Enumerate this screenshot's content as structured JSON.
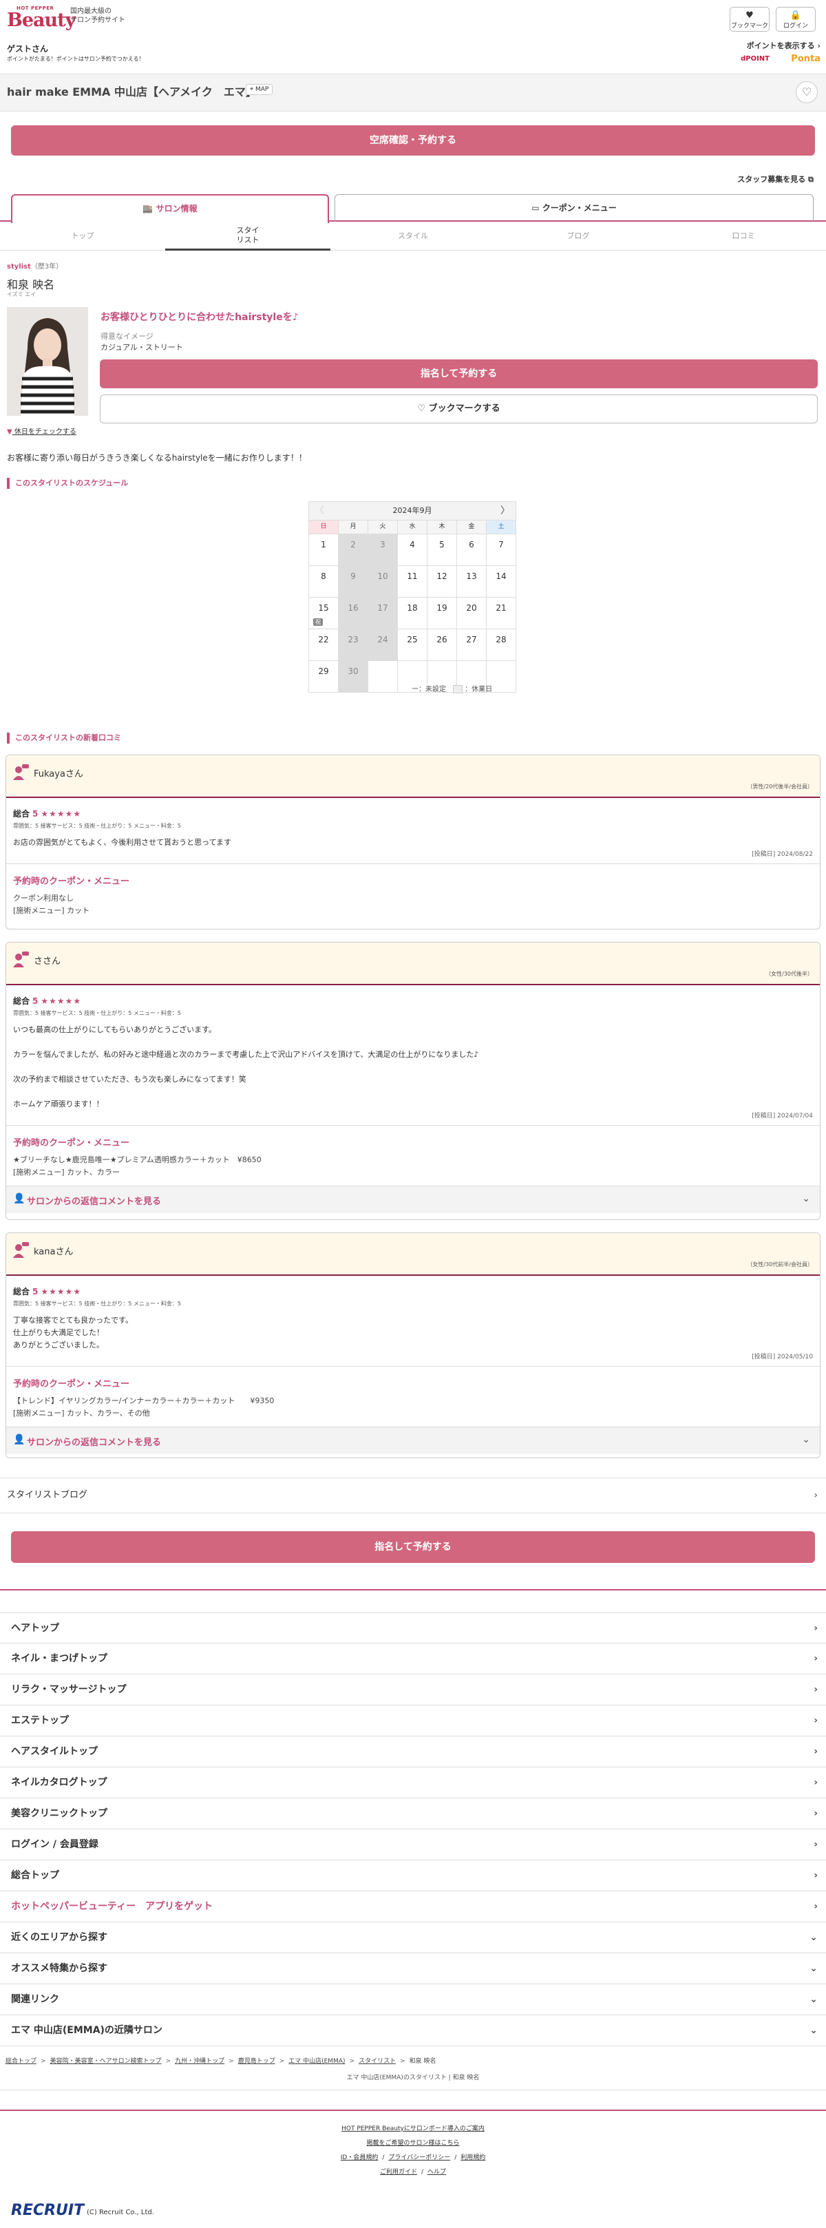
{
  "header": {
    "hp_brand": "HOT PEPPER",
    "beauty": "Beauty",
    "tagline": "国内最大級の\nサロン予約サイト",
    "bookmark_label": "ブックマーク",
    "login_label": "ログイン",
    "guest": "ゲストさん",
    "point_note": "ポイントがたまる！ポイントはサロン予約でつかえる！",
    "show_points": "ポイントを表示する",
    "dpoint": "dPOINT",
    "ponta": "Ponta"
  },
  "salon": {
    "name": "hair make EMMA 中山店【ヘアメイク　エマ】",
    "map": "MAP"
  },
  "reserve_label": "空席確認・予約する",
  "staff_recruit": "スタッフ募集を見る",
  "tabs": {
    "salon_info": "サロン情報",
    "coupon_menu": "クーポン・メニュー"
  },
  "subtabs": {
    "top": "トップ",
    "stylist": "スタイ\nリスト",
    "style": "スタイル",
    "blog": "ブログ",
    "review": "口コミ"
  },
  "stylist": {
    "role": "stylist",
    "years": "（歴3年）",
    "name": "和泉 映名",
    "kana": "イズミ エイ",
    "catch": "お客様ひとりひとりに合わせたhairstyleを♪",
    "image_label": "得意なイメージ",
    "image_value": "カジュアル・ストリート",
    "nominate": "指名して予約する",
    "bookmark": "ブックマークする",
    "holiday_link": "休日をチェックする",
    "message": "お客様に寄り添い毎日がうきうき楽しくなるhairstyleを一緒にお作りします！！"
  },
  "schedule": {
    "title": "このスタイリストのスケジュール",
    "month": "2024年9月",
    "prev": "〈",
    "next": "〉",
    "dows": [
      "日",
      "月",
      "火",
      "水",
      "木",
      "金",
      "土"
    ],
    "days": [
      [
        "1",
        "2",
        "3",
        "4",
        "5",
        "6",
        "7"
      ],
      [
        "8",
        "9",
        "10",
        "11",
        "12",
        "13",
        "14"
      ],
      [
        "15",
        "16",
        "17",
        "18",
        "19",
        "20",
        "21"
      ],
      [
        "22",
        "23",
        "24",
        "25",
        "26",
        "27",
        "28"
      ],
      [
        "29",
        "30",
        "",
        "",
        "",
        "",
        ""
      ]
    ],
    "holiday_badge": "祝",
    "legend_unset": "ー：未設定",
    "legend_off": "：休業日"
  },
  "reviews_title": "このスタイリストの新着口コミ",
  "reviews": [
    {
      "name": "Fukayaさん",
      "meta": "（男性/20代後半/会社員）",
      "total_label": "総合",
      "score": "5",
      "stars": "★★★★★",
      "cats": "雰囲気：5  接客サービス：5  技術・仕上がり：5  メニュー・料金：5",
      "text": "お店の雰囲気がとてもよく、今後利用させて貰おうと思ってます",
      "date": "[投稿日] 2024/08/22",
      "coupon_title": "予約時のクーポン・メニュー",
      "coupon1": "クーポン利用なし",
      "coupon2": "[施術メニュー] カット"
    },
    {
      "name": "ささん",
      "meta": "（女性/30代後半）",
      "total_label": "総合",
      "score": "5",
      "stars": "★★★★★",
      "cats": "雰囲気：5  接客サービス：5  技術・仕上がり：5  メニュー・料金：5",
      "text": "いつも最高の仕上がりにしてもらいありがとうございます。\n\nカラーを悩んでましたが、私の好みと途中経過と次のカラーまで考慮した上で沢山アドバイスを頂けて、大満足の仕上がりになりました♪\n\n次の予約まで相談させていただき、もう次も楽しみになってます！笑\n\nホームケア頑張ります！！",
      "date": "[投稿日] 2024/07/04",
      "coupon_title": "予約時のクーポン・メニュー",
      "coupon1": "★ブリーチなし★鹿児島唯一★プレミアム透明感カラー＋カット　¥8650",
      "coupon2": "[施術メニュー] カット、カラー",
      "reply": "サロンからの返信コメントを見る"
    },
    {
      "name": "kanaさん",
      "meta": "（女性/30代前半/会社員）",
      "total_label": "総合",
      "score": "5",
      "stars": "★★★★★",
      "cats": "雰囲気：5  接客サービス：5  技術・仕上がり：5  メニュー・料金：5",
      "text": "丁寧な接客でとても良かったです。\n仕上がりも大満足でした！\nありがとうございました。",
      "date": "[投稿日] 2024/05/10",
      "coupon_title": "予約時のクーポン・メニュー",
      "coupon1": "【トレンド】イヤリングカラー/インナーカラー＋カラー＋カット　　¥9350",
      "coupon2": "[施術メニュー] カット、カラー、その他",
      "reply": "サロンからの返信コメントを見る"
    }
  ],
  "blog_label": "スタイリストブログ",
  "nominate2": "指名して予約する",
  "nav": [
    "ヘアトップ",
    "ネイル・まつげトップ",
    "リラク・マッサージトップ",
    "エステトップ",
    "ヘアスタイルトップ",
    "ネイルカタログトップ",
    "美容クリニックトップ",
    "ログイン / 会員登録",
    "総合トップ",
    "ホットペッパービューティー　アプリをゲット",
    "近くのエリアから探す",
    "オススメ特集から探す",
    "関連リンク",
    "エマ 中山店(EMMA)の近隣サロン"
  ],
  "breadcrumbs": [
    "総合トップ",
    "美容院・美容室・ヘアサロン検索トップ",
    "九州・沖縄トップ",
    "鹿児島トップ",
    "エマ 中山店(EMMA)",
    "スタイリスト"
  ],
  "breadcrumb_current": "和泉 映名",
  "page_title": "エマ 中山店(EMMA)のスタイリスト | 和泉 映名",
  "footer": {
    "l1": "HOT PEPPER Beautyにサロンボード導入のご案内",
    "l2": "掲載をご希望のサロン様はこちら",
    "l3a": "ID・会員規約",
    "l3b": "プライバシーポリシー",
    "l3c": "利用規約",
    "l4a": "ご利用ガイド",
    "l4b": "ヘルプ",
    "recruit": "RECRUIT",
    "copy": "(C) Recruit Co., Ltd."
  }
}
